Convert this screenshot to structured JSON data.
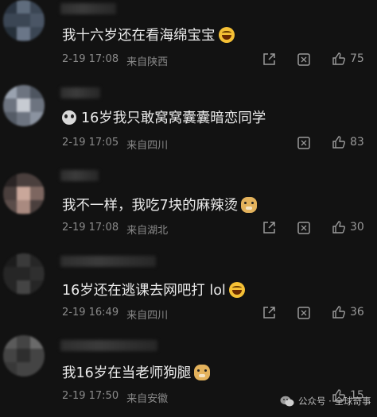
{
  "comments": [
    {
      "text": "我十六岁还在看海绵宝宝",
      "emoji": "laughing-tears",
      "date": "2-19 17:08",
      "location": "来自陕西",
      "likes": "75"
    },
    {
      "text": "16岁我只敢窝窝囊囊暗恋同学",
      "emoji": "sad-face",
      "date": "2-19 17:05",
      "location": "来自四川",
      "likes": "83"
    },
    {
      "text": "我不一样，我吃7块的麻辣烫",
      "emoji": "doge",
      "date": "2-19 17:08",
      "location": "来自湖北",
      "likes": "30"
    },
    {
      "text": "16岁还在逃课去网吧打 lol",
      "emoji": "laughing-tears",
      "date": "2-19 16:49",
      "location": "来自四川",
      "likes": "36"
    },
    {
      "text": "我16岁在当老师狗腿",
      "emoji": "doge",
      "date": "2-19 17:50",
      "location": "来自安徽",
      "likes": "15"
    }
  ],
  "watermark": {
    "label": "公众号 · 全球奇事",
    "icon": "wechat-icon"
  },
  "colors": {
    "background": "#121212",
    "text": "#eaeaea",
    "meta": "#8a8a8a"
  }
}
